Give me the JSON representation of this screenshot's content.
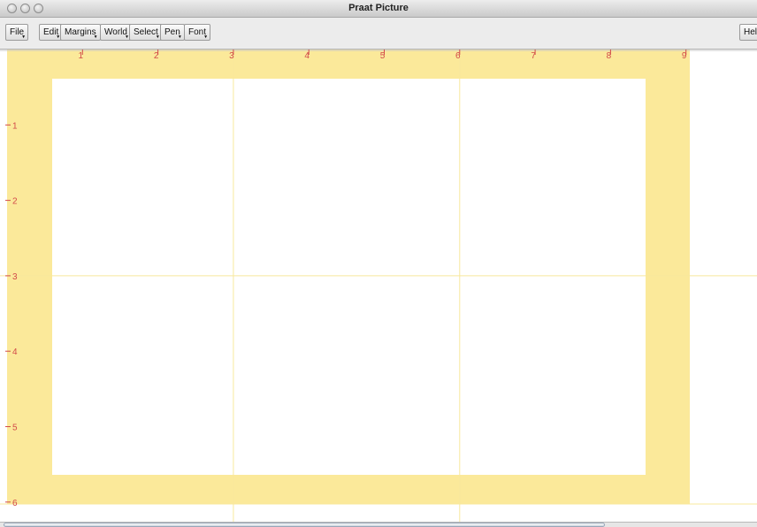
{
  "window": {
    "title": "Praat Picture"
  },
  "menu": {
    "items": [
      "File",
      "Edit",
      "Margins",
      "World",
      "Select",
      "Pen",
      "Font"
    ],
    "help": "Hel"
  },
  "picture": {
    "ruler_color": "#d24a4a",
    "selection_color": "#fbe99a",
    "grid_color": "#f8e89c",
    "x_ticks": [
      "1",
      "2",
      "3",
      "4",
      "5",
      "6",
      "7",
      "8",
      "9"
    ],
    "y_ticks": [
      "1",
      "2",
      "3",
      "4",
      "5",
      "6"
    ]
  }
}
